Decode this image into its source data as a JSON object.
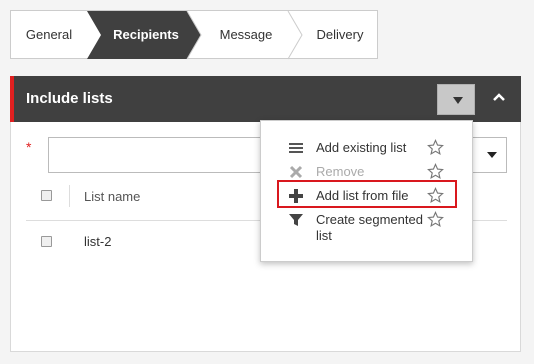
{
  "steps": [
    {
      "label": "General"
    },
    {
      "label": "Recipients",
      "active": true
    },
    {
      "label": "Message"
    },
    {
      "label": "Delivery"
    }
  ],
  "panel": {
    "title": "Include lists",
    "required_marker": "*",
    "table": {
      "header": "List name",
      "rows": [
        {
          "name": "list-2"
        }
      ]
    }
  },
  "menu": {
    "items": [
      {
        "label": "Add existing list",
        "icon": "list-icon",
        "disabled": false
      },
      {
        "label": "Remove",
        "icon": "remove-icon",
        "disabled": true
      },
      {
        "label": "Add list from file",
        "icon": "plus-icon",
        "disabled": false,
        "highlighted": true
      },
      {
        "label": "Create segmented list",
        "label_line1": "Create segmented",
        "label_line2": "list",
        "icon": "funnel-icon",
        "disabled": false
      }
    ]
  },
  "colors": {
    "header_bg": "#404040",
    "accent_red": "#e02020",
    "active_step_bg": "#404040"
  }
}
